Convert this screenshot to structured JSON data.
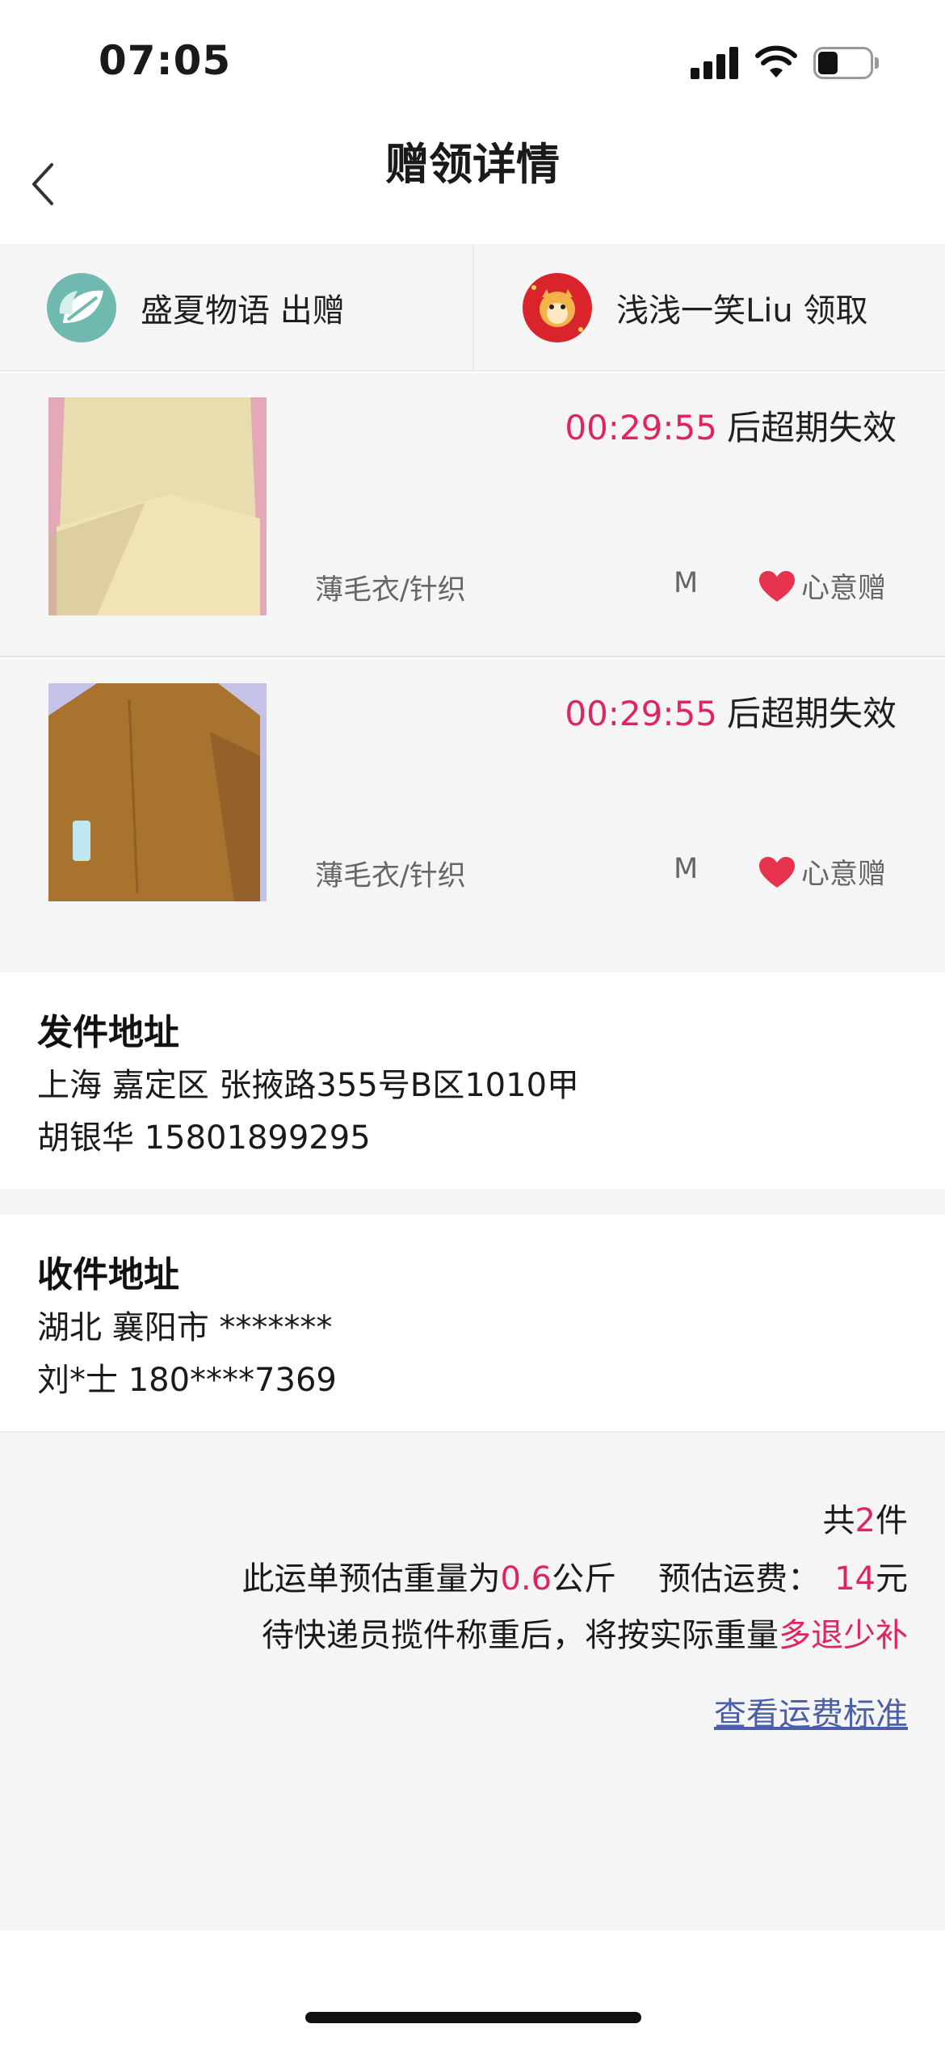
{
  "status_bar": {
    "time": "07:05"
  },
  "nav": {
    "title": "赠领详情"
  },
  "users": {
    "giver": {
      "name": "盛夏物语",
      "action": "出赠",
      "display": "盛夏物语 出赠"
    },
    "receiver": {
      "name": "浅浅一笑Liu",
      "action": "领取",
      "display": "浅浅一笑Liu 领取"
    }
  },
  "items": [
    {
      "countdown": "00:29:55",
      "countdown_suffix": "后超期失效",
      "category": "薄毛衣/针织",
      "size": "M",
      "tag": "心意赠",
      "photo_color": "#e4d9a8"
    },
    {
      "countdown": "00:29:55",
      "countdown_suffix": "后超期失效",
      "category": "薄毛衣/针织",
      "size": "M",
      "tag": "心意赠",
      "photo_color": "#a8722f"
    }
  ],
  "send_address": {
    "title": "发件地址",
    "line1": "上海 嘉定区 张掖路355号B区1010甲",
    "line2": "胡银华 15801899295"
  },
  "recv_address": {
    "title": "收件地址",
    "line1": "湖北 襄阳市 *******",
    "line2": "刘*士 180****7369"
  },
  "summary": {
    "count_prefix": "共",
    "count": "2",
    "count_suffix": "件",
    "weight_prefix": "此运单预估重量为",
    "weight": "0.6",
    "weight_unit": "公斤",
    "fee_label": "预估运费：",
    "fee": "14",
    "fee_unit": "元",
    "note_prefix": "待快递员揽件称重后，将按实际重量",
    "note_highlight": "多退少补",
    "fee_link": "查看运费标准"
  },
  "colors": {
    "accent": "#e0245e",
    "link": "#4a5fa8",
    "background": "#f5f5f5"
  },
  "icons": {
    "back": "chevron-left-icon",
    "heart": "heart-icon",
    "signal": "signal-icon",
    "wifi": "wifi-icon",
    "battery": "battery-icon"
  }
}
